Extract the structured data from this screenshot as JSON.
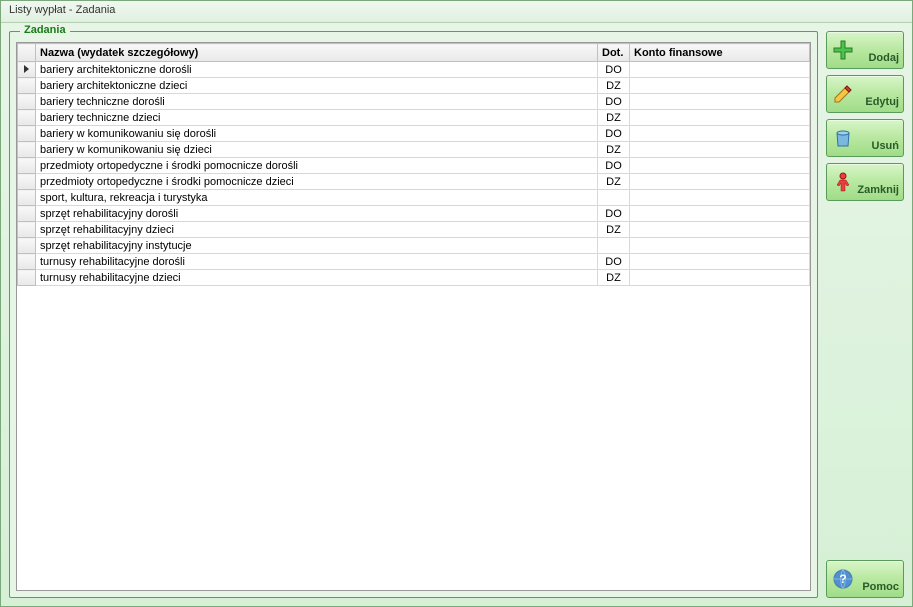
{
  "window": {
    "title": "Listy wypłat - Zadania"
  },
  "group": {
    "title": "Zadania"
  },
  "table": {
    "headers": {
      "nazwa": "Nazwa (wydatek szczegółowy)",
      "dot": "Dot.",
      "konto": "Konto finansowe"
    },
    "rows": [
      {
        "nazwa": "bariery architektoniczne dorośli",
        "dot": "DO",
        "konto": "",
        "current": true
      },
      {
        "nazwa": "bariery architektoniczne dzieci",
        "dot": "DZ",
        "konto": ""
      },
      {
        "nazwa": "bariery techniczne dorośli",
        "dot": "DO",
        "konto": ""
      },
      {
        "nazwa": "bariery techniczne dzieci",
        "dot": "DZ",
        "konto": ""
      },
      {
        "nazwa": "bariery w komunikowaniu się dorośli",
        "dot": "DO",
        "konto": ""
      },
      {
        "nazwa": "bariery w komunikowaniu się dzieci",
        "dot": "DZ",
        "konto": ""
      },
      {
        "nazwa": "przedmioty ortopedyczne i środki pomocnicze dorośli",
        "dot": "DO",
        "konto": ""
      },
      {
        "nazwa": "przedmioty ortopedyczne i środki pomocnicze dzieci",
        "dot": "DZ",
        "konto": ""
      },
      {
        "nazwa": "sport, kultura, rekreacja i turystyka",
        "dot": "",
        "konto": ""
      },
      {
        "nazwa": "sprzęt rehabilitacyjny dorośli",
        "dot": "DO",
        "konto": ""
      },
      {
        "nazwa": "sprzęt rehabilitacyjny dzieci",
        "dot": "DZ",
        "konto": ""
      },
      {
        "nazwa": "sprzęt rehabilitacyjny instytucje",
        "dot": "",
        "konto": ""
      },
      {
        "nazwa": "turnusy rehabilitacyjne dorośli",
        "dot": "DO",
        "konto": ""
      },
      {
        "nazwa": "turnusy rehabilitacyjne dzieci",
        "dot": "DZ",
        "konto": ""
      }
    ]
  },
  "buttons": {
    "add": "Dodaj",
    "edit": "Edytuj",
    "delete": "Usuń",
    "close": "Zamknij",
    "help": "Pomoc"
  }
}
